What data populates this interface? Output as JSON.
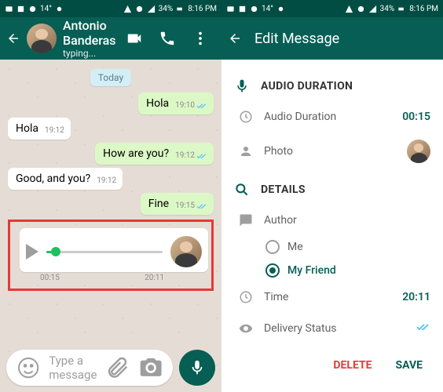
{
  "status": {
    "time": "8:16 PM",
    "battery": "34%",
    "temp": "14°"
  },
  "left": {
    "contact": "Antonio Banderas",
    "typing": "typing...",
    "datePill": "Today",
    "messages": {
      "m1": {
        "text": "Hola",
        "time": "19:10"
      },
      "m2": {
        "text": "Hola",
        "time": "19:12"
      },
      "m3": {
        "text": "How are you?",
        "time": "19:12"
      },
      "m4": {
        "text": "Good, and you?",
        "time": "19:12"
      },
      "m5": {
        "text": "Fine",
        "time": "19:15"
      }
    },
    "voice": {
      "elapsed": "00:15",
      "total": "20:11"
    },
    "input": {
      "placeholder": "Type a message"
    }
  },
  "right": {
    "title": "Edit Message",
    "sections": {
      "audio": "AUDIO DURATION",
      "details": "DETAILS"
    },
    "rows": {
      "duration": {
        "label": "Audio Duration",
        "value": "00:15"
      },
      "photo": {
        "label": "Photo"
      },
      "author": {
        "label": "Author"
      },
      "authorOptions": {
        "me": "Me",
        "friend": "My Friend"
      },
      "time": {
        "label": "Time",
        "value": "20:11"
      },
      "delivery": {
        "label": "Delivery Status"
      }
    },
    "footer": {
      "delete": "DELETE",
      "save": "SAVE"
    }
  }
}
